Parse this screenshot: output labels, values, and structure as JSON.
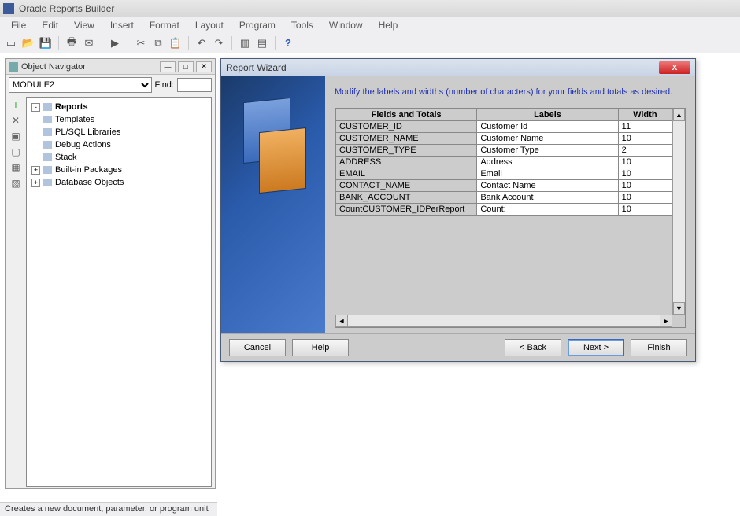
{
  "app_title": "Oracle Reports Builder",
  "menus": [
    "File",
    "Edit",
    "View",
    "Insert",
    "Format",
    "Layout",
    "Program",
    "Tools",
    "Window",
    "Help"
  ],
  "navigator": {
    "title": "Object Navigator",
    "module": "MODULE2",
    "find_label": "Find:",
    "items": [
      {
        "exp": "-",
        "label": "Reports",
        "bold": true
      },
      {
        "exp": "",
        "label": "Templates"
      },
      {
        "exp": "",
        "label": "PL/SQL Libraries"
      },
      {
        "exp": "",
        "label": "Debug Actions"
      },
      {
        "exp": "",
        "label": "Stack"
      },
      {
        "exp": "+",
        "label": "Built-in Packages"
      },
      {
        "exp": "+",
        "label": "Database Objects"
      }
    ]
  },
  "status": "Creates a new document, parameter, or program unit",
  "wizard": {
    "title": "Report Wizard",
    "instruction": "Modify the labels and widths (number of characters) for your fields and totals as desired.",
    "columns": [
      "Fields and Totals",
      "Labels",
      "Width"
    ],
    "rows": [
      {
        "field": "CUSTOMER_ID",
        "label": "Customer Id",
        "width": "11"
      },
      {
        "field": "CUSTOMER_NAME",
        "label": "Customer Name",
        "width": "10"
      },
      {
        "field": "CUSTOMER_TYPE",
        "label": "Customer Type",
        "width": "2"
      },
      {
        "field": "ADDRESS",
        "label": "Address",
        "width": "10"
      },
      {
        "field": "EMAIL",
        "label": "Email",
        "width": "10"
      },
      {
        "field": "CONTACT_NAME",
        "label": "Contact Name",
        "width": "10"
      },
      {
        "field": "BANK_ACCOUNT",
        "label": "Bank Account",
        "width": "10"
      },
      {
        "field": "CountCUSTOMER_IDPerReport",
        "label": "Count:",
        "width": "10"
      }
    ],
    "buttons": {
      "cancel": "Cancel",
      "help": "Help",
      "back": "< Back",
      "next": "Next >",
      "finish": "Finish"
    }
  }
}
